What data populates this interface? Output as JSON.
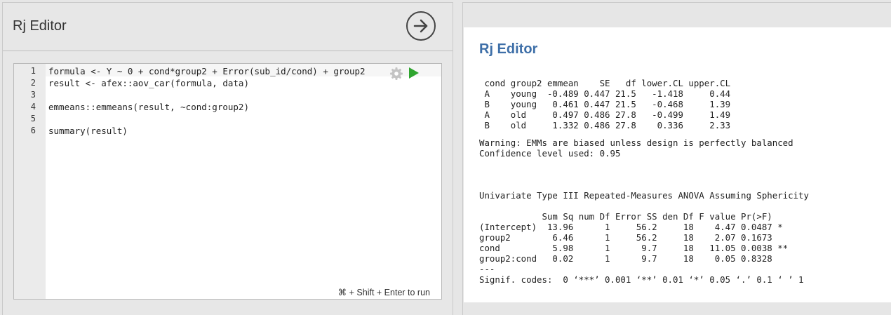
{
  "editor_panel": {
    "title": "Rj Editor",
    "run_hint": "⌘ + Shift + Enter to run",
    "lines": [
      {
        "number": "1",
        "code": "formula <- Y ~ 0 + cond*group2 + Error(sub_id/cond) + group2"
      },
      {
        "number": "2",
        "code": "result <- afex::aov_car(formula, data)"
      },
      {
        "number": "3",
        "code": ""
      },
      {
        "number": "4",
        "code": "emmeans::emmeans(result, ~cond:group2)"
      },
      {
        "number": "5",
        "code": ""
      },
      {
        "number": "6",
        "code": "summary(result)"
      }
    ]
  },
  "results_panel": {
    "title": "Rj Editor",
    "emmeans_table": " cond group2 emmean    SE   df lower.CL upper.CL\n A    young  -0.489 0.447 21.5   -1.418     0.44\n B    young   0.461 0.447 21.5   -0.468     1.39\n A    old     0.497 0.486 27.8   -0.499     1.49\n B    old     1.332 0.486 27.8    0.336     2.33",
    "notes": "Warning: EMMs are biased unless design is perfectly balanced\nConfidence level used: 0.95",
    "anova_heading": "Univariate Type III Repeated-Measures ANOVA Assuming Sphericity",
    "anova_table": "            Sum Sq num Df Error SS den Df F value Pr(>F)  \n(Intercept)  13.96      1     56.2     18    4.47 0.0487 *\ngroup2        6.46      1     56.2     18    2.07 0.1673  \ncond          5.98      1      9.7     18   11.05 0.0038 **\ngroup2:cond   0.02      1      9.7     18    0.05 0.8328  \n---\nSignif. codes:  0 ‘***’ 0.001 ‘**’ 0.01 ‘*’ 0.05 ‘.’ 0.1 ‘ ’ 1"
  },
  "colors": {
    "accent_title": "#3e6fa8",
    "run_green": "#2fa52f"
  }
}
